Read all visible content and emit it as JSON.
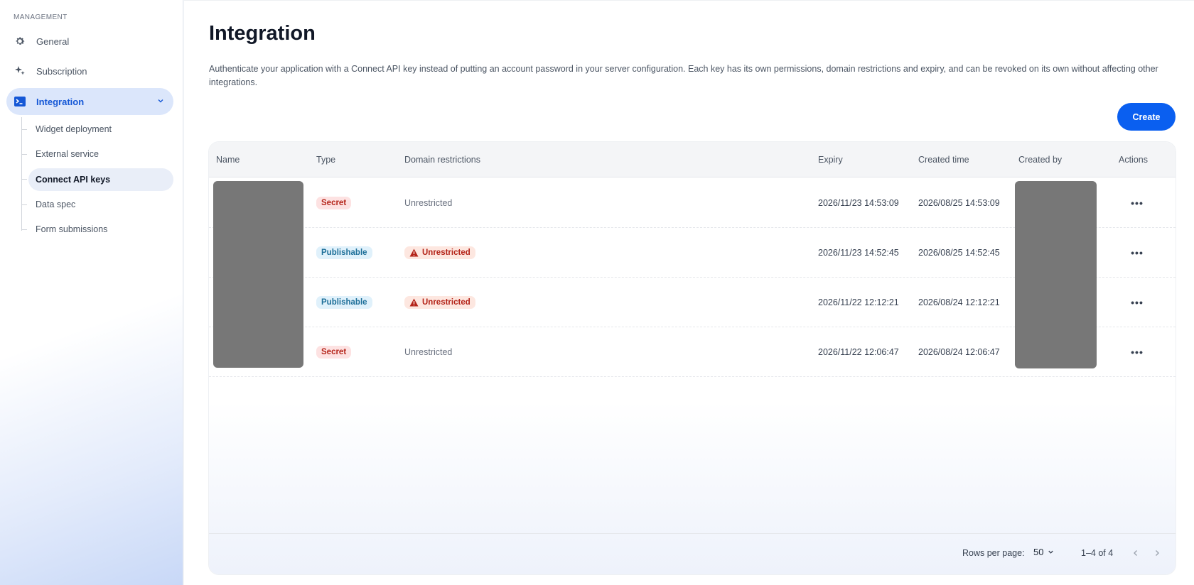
{
  "sidebar": {
    "section_label": "MANAGEMENT",
    "items": [
      {
        "label": "General",
        "icon": "gear-icon"
      },
      {
        "label": "Subscription",
        "icon": "sparkle-icon"
      },
      {
        "label": "Integration",
        "icon": "terminal-icon"
      }
    ],
    "sub_items": [
      {
        "label": "Widget deployment"
      },
      {
        "label": "External service"
      },
      {
        "label": "Connect API keys"
      },
      {
        "label": "Data spec"
      },
      {
        "label": "Form submissions"
      }
    ]
  },
  "main": {
    "title": "Integration",
    "description": "Authenticate your application with a Connect API key instead of putting an account password in your server configuration. Each key has its own permissions, domain restrictions and expiry, and can be revoked on its own without affecting other integrations.",
    "create_label": "Create"
  },
  "table": {
    "columns": [
      "Name",
      "Type",
      "Domain restrictions",
      "Expiry",
      "Created time",
      "Created by",
      "Actions"
    ],
    "rows": [
      {
        "type": "Secret",
        "domain": "Unrestricted",
        "domain_warning": false,
        "expiry": "2026/11/23 14:53:09",
        "created": "2026/08/25 14:53:09"
      },
      {
        "type": "Publishable",
        "domain": "Unrestricted",
        "domain_warning": true,
        "expiry": "2026/11/23 14:52:45",
        "created": "2026/08/25 14:52:45"
      },
      {
        "type": "Publishable",
        "domain": "Unrestricted",
        "domain_warning": true,
        "expiry": "2026/11/22 12:12:21",
        "created": "2026/08/24 12:12:21"
      },
      {
        "type": "Secret",
        "domain": "Unrestricted",
        "domain_warning": false,
        "expiry": "2026/11/22 12:06:47",
        "created": "2026/08/24 12:06:47"
      }
    ],
    "actions_label": "•••"
  },
  "pagination": {
    "rows_per_page_label": "Rows per page:",
    "rows_per_page_value": "50",
    "range_label": "1–4 of 4"
  },
  "colors": {
    "accent": "#0a5ff0",
    "active_nav_bg": "#dbe6fb",
    "secret_badge_bg": "#fde2e2",
    "publishable_badge_bg": "#e0f1fb"
  }
}
